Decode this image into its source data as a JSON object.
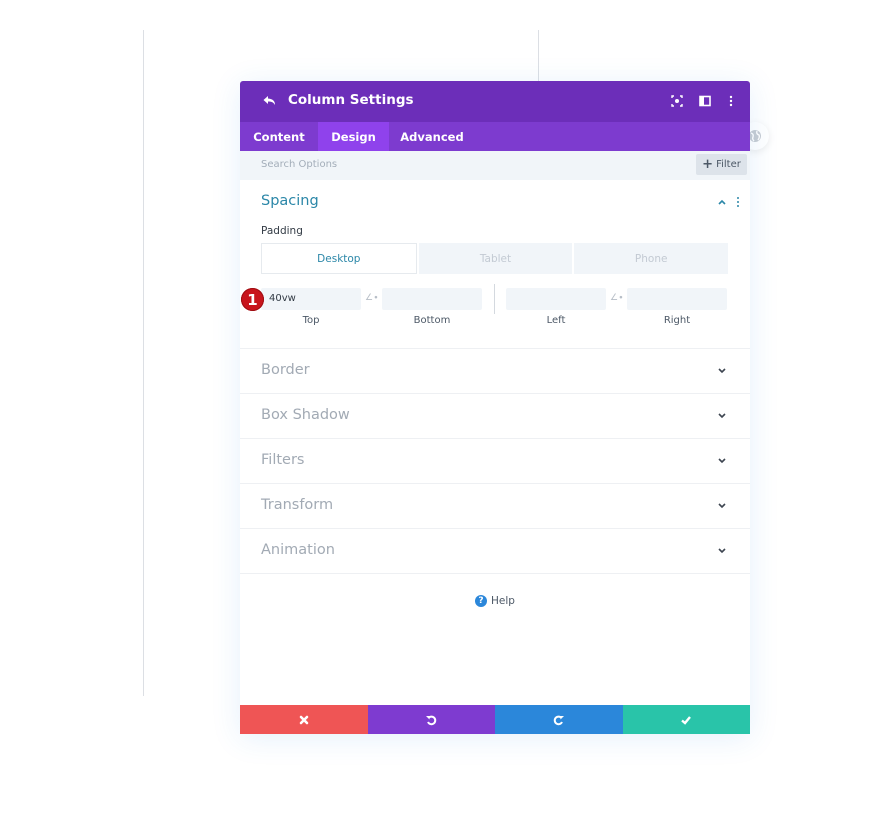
{
  "header": {
    "title": "Column Settings",
    "icons": [
      "back-arrow-icon",
      "focus-icon",
      "split-view-icon",
      "more-options-icon"
    ]
  },
  "tabs": [
    {
      "label": "Content",
      "active": false
    },
    {
      "label": "Design",
      "active": true
    },
    {
      "label": "Advanced",
      "active": false
    }
  ],
  "search": {
    "placeholder": "Search Options",
    "filter_label": "Filter"
  },
  "spacing": {
    "title": "Spacing",
    "padding_label": "Padding",
    "device_tabs": [
      {
        "label": "Desktop",
        "active": true
      },
      {
        "label": "Tablet",
        "active": false
      },
      {
        "label": "Phone",
        "active": false
      }
    ],
    "fields": [
      {
        "label": "Top",
        "value": "40vw"
      },
      {
        "label": "Bottom",
        "value": ""
      },
      {
        "label": "Left",
        "value": ""
      },
      {
        "label": "Right",
        "value": ""
      }
    ],
    "step_badge": "1"
  },
  "sections": [
    {
      "label": "Border"
    },
    {
      "label": "Box Shadow"
    },
    {
      "label": "Filters"
    },
    {
      "label": "Transform"
    },
    {
      "label": "Animation"
    }
  ],
  "help": {
    "label": "Help"
  },
  "footer": {
    "buttons": [
      {
        "name": "discard",
        "color": "#ef5555"
      },
      {
        "name": "undo",
        "color": "#7e3bd0"
      },
      {
        "name": "redo",
        "color": "#2b87da"
      },
      {
        "name": "save",
        "color": "#29c4a9"
      }
    ]
  },
  "colors": {
    "header": "#6c2eb9",
    "tabs": "#7d3bcf",
    "active_tab": "#8f42ec",
    "accent_text": "#2b87a8",
    "badge": "#c8151c"
  }
}
